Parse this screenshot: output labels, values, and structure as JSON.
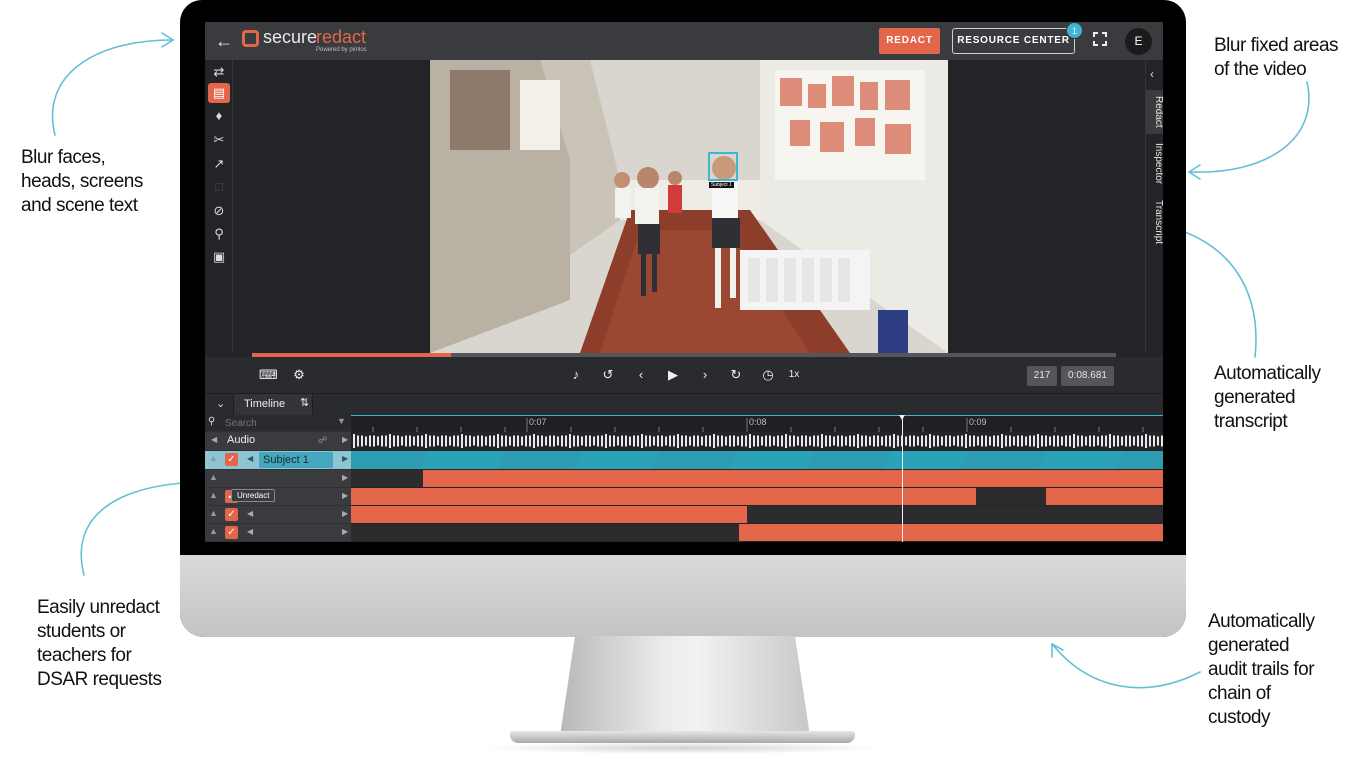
{
  "callouts": {
    "left_top": [
      "Blur faces,",
      "heads, screens",
      "and scene text"
    ],
    "left_bottom": [
      "Easily unredact",
      "students or",
      "teachers for",
      "DSAR requests"
    ],
    "right_top": [
      "Blur fixed areas",
      "of the video"
    ],
    "right_mid": [
      "Automatically",
      "generated",
      "transcript"
    ],
    "right_bottom": [
      "Automatically",
      "generated",
      "audit trails for",
      "chain of",
      "custody"
    ]
  },
  "app": {
    "logo_part1": "secure",
    "logo_part2": "redact",
    "logo_powered": "Powered by pimloc",
    "redact_label": "REDACT",
    "resource_label": "RESOURCE CENTER",
    "notification_count": "1",
    "avatar_initial": "E"
  },
  "side_tabs": [
    "Redact",
    "Inspector",
    "Transcript"
  ],
  "video": {
    "subject_tag": "Subject 1"
  },
  "player": {
    "progress_fraction": 0.23,
    "speed": "1x",
    "frame": "217",
    "time": "0:08.681"
  },
  "timeline": {
    "tab_label": "Timeline",
    "search_placeholder": "Search",
    "audio_label": "Audio",
    "subject_label": "Subject 1",
    "tooltip": "Unredact",
    "ruler_labels": [
      "0:07",
      "0:08",
      "0:09"
    ]
  },
  "colors": {
    "accent": "#e4664a",
    "cyan": "#3db6d4",
    "panel": "#232427"
  },
  "icons": {
    "tools": [
      "swap-icon",
      "trash-list-icon",
      "tag-icon",
      "scissors-icon",
      "trend-icon",
      "select-box-icon",
      "no-hearing-icon",
      "zoom-icon",
      "frame-select-icon"
    ]
  }
}
